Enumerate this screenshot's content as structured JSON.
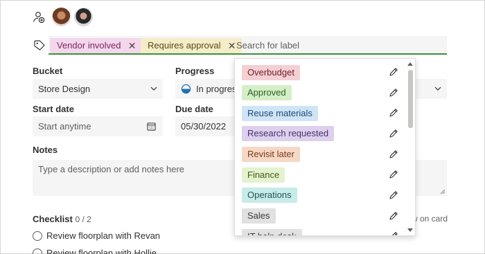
{
  "assignees": {
    "add_icon": "add-person-icon",
    "people": [
      "avatar-1",
      "avatar-2"
    ]
  },
  "labels": {
    "icon": "tag-icon",
    "chips": [
      {
        "text": "Vendor involved",
        "bg": "#f4d7ec"
      },
      {
        "text": "Requires approval",
        "bg": "#f5ecc9"
      }
    ],
    "search_placeholder": "Search for label",
    "underline_color": "#3d8f3d"
  },
  "bucket": {
    "label": "Bucket",
    "value": "Store Design"
  },
  "progress": {
    "label": "Progress",
    "value": "In progres"
  },
  "start_date": {
    "label": "Start date",
    "placeholder": "Start anytime"
  },
  "due_date": {
    "label": "Due date",
    "value": "05/30/2022"
  },
  "notes": {
    "label": "Notes",
    "placeholder": "Type a description or add notes here"
  },
  "checklist": {
    "title": "Checklist",
    "count": "0 / 2",
    "show_on_card": "w on card",
    "items": [
      "Review floorplan with Revan",
      "Review floorplan with Hollie"
    ]
  },
  "label_menu": {
    "items": [
      {
        "text": "Overbudget",
        "bg": "#f4cfd4",
        "fg": "#6e1e28"
      },
      {
        "text": "Approved",
        "bg": "#d4efc8",
        "fg": "#2b5c1f"
      },
      {
        "text": "Reuse materials",
        "bg": "#cfe4f7",
        "fg": "#1c4a73"
      },
      {
        "text": "Research requested",
        "bg": "#ddd0ec",
        "fg": "#4a2f6e"
      },
      {
        "text": "Revisit later",
        "bg": "#f6d8c6",
        "fg": "#7a3d1c"
      },
      {
        "text": "Finance",
        "bg": "#e4f2cf",
        "fg": "#3f5b17"
      },
      {
        "text": "Operations",
        "bg": "#c7ebe8",
        "fg": "#1e5652"
      },
      {
        "text": "Sales",
        "bg": "#e1e1e1",
        "fg": "#3b3b3b"
      },
      {
        "text": "IT help desk",
        "bg": "#e1e1e1",
        "fg": "#3b3b3b"
      }
    ]
  }
}
